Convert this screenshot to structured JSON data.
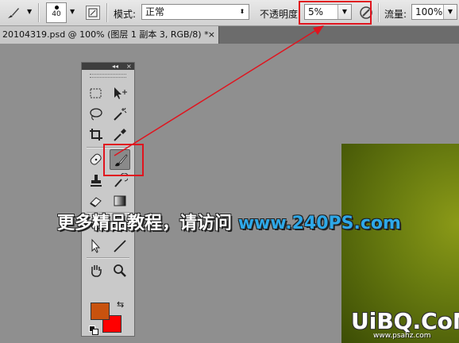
{
  "options_bar": {
    "brush_size": "40",
    "mode_label": "模式:",
    "mode_value": "正常",
    "opacity_label": "不透明度:",
    "opacity_value": "5%",
    "flow_label": "流量:",
    "flow_value": "100%"
  },
  "document_tab": {
    "title": "20104319.psd @ 100% (图层 1 副本 3, RGB/8) *",
    "close": "×"
  },
  "tools_panel": {
    "collapse": "◂◂",
    "close": "×",
    "active_tool": "brush-tool",
    "foreground_color": "#c8520e",
    "background_color": "#ff0000"
  },
  "watermark": {
    "text": "更多精品教程，请访问",
    "url": "www.240PS.com",
    "logo": "UiBQ.CoM",
    "logo_sub": "www.psahz.com"
  },
  "colors": {
    "highlight": "#e0141e",
    "canvas": "#6a7d10"
  }
}
